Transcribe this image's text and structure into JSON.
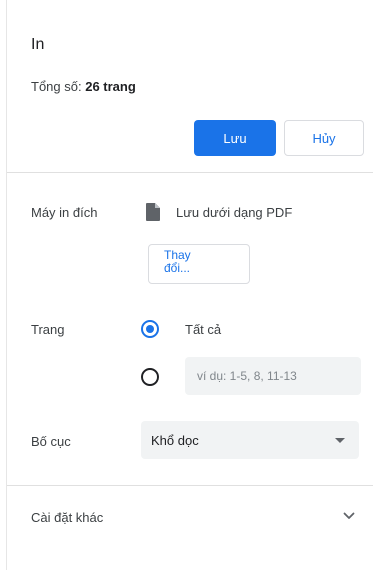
{
  "dialog": {
    "title": "In",
    "total_label": "Tổng số:",
    "total_value": "26 trang"
  },
  "actions": {
    "save_label": "Lưu",
    "cancel_label": "Hủy"
  },
  "destination": {
    "label": "Máy in đích",
    "icon": "document-icon",
    "value": "Lưu dưới dạng PDF",
    "change_label": "Thay\nđổi..."
  },
  "pages": {
    "label": "Trang",
    "all_label": "Tất cả",
    "all_selected": true,
    "custom_placeholder": "ví dụ: 1-5, 8, 11-13",
    "custom_value": ""
  },
  "layout": {
    "label": "Bố cục",
    "selected": "Khổ dọc"
  },
  "more_settings": {
    "label": "Cài đặt khác",
    "icon": "chevron-down-icon"
  },
  "colors": {
    "accent": "#1a73e8",
    "field_bg": "#f1f3f4",
    "divider": "#e0e0e0"
  }
}
